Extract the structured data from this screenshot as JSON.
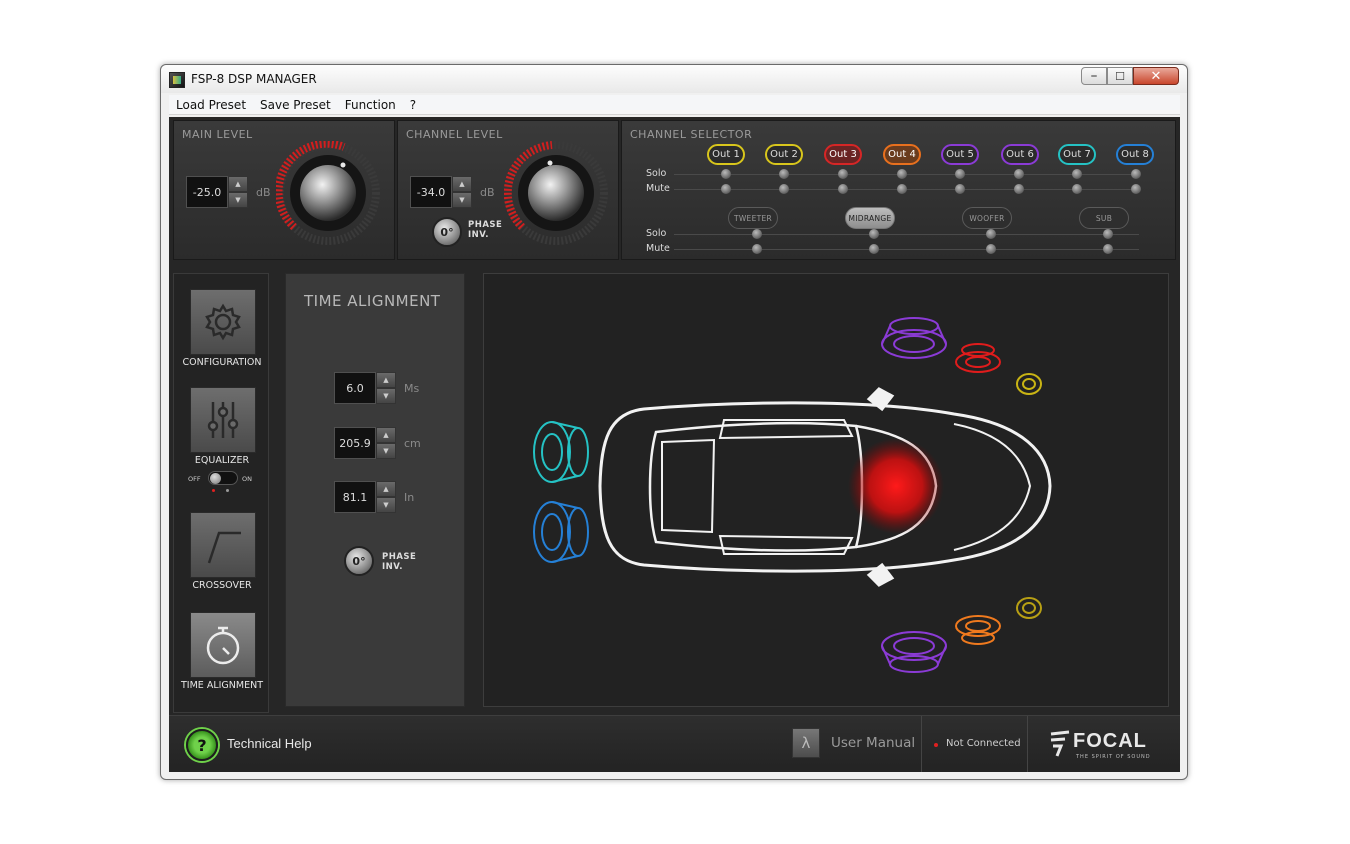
{
  "window": {
    "title": "FSP-8 DSP MANAGER"
  },
  "menu": [
    "Load Preset",
    "Save Preset",
    "Function",
    "?"
  ],
  "main_level": {
    "label": "MAIN LEVEL",
    "value": "-25.0",
    "unit": "dB"
  },
  "channel_level": {
    "label": "CHANNEL LEVEL",
    "value": "-34.0",
    "unit": "dB",
    "phase": "0°",
    "phase_label_1": "PHASE",
    "phase_label_2": "INV."
  },
  "channel_selector": {
    "label": "CHANNEL SELECTOR",
    "outputs": [
      {
        "label": "Out 1",
        "color": "#d8c61c"
      },
      {
        "label": "Out 2",
        "color": "#d8c61c"
      },
      {
        "label": "Out 3",
        "color": "#d62626"
      },
      {
        "label": "Out 4",
        "color": "#e8701e"
      },
      {
        "label": "Out 5",
        "color": "#8b3bd6"
      },
      {
        "label": "Out 6",
        "color": "#8b3bd6"
      },
      {
        "label": "Out 7",
        "color": "#25c2c4"
      },
      {
        "label": "Out 8",
        "color": "#2580d6"
      }
    ],
    "solo_label": "Solo",
    "mute_label": "Mute",
    "groups": [
      "TWEETER",
      "MIDRANGE",
      "WOOFER",
      "SUB"
    ],
    "active_group": "MIDRANGE"
  },
  "nav": {
    "configuration": "CONFIGURATION",
    "equalizer": "EQUALIZER",
    "toggle_off": "OFF",
    "toggle_on": "ON",
    "crossover": "CROSSOVER",
    "time_alignment": "TIME ALIGNMENT"
  },
  "time_alignment": {
    "title": "TIME ALIGNMENT",
    "ms_value": "6.0",
    "ms_unit": "Ms",
    "cm_value": "205.9",
    "cm_unit": "cm",
    "in_value": "81.1",
    "in_unit": "In",
    "phase": "0°",
    "phase_label_1": "PHASE",
    "phase_label_2": "INV."
  },
  "footer": {
    "help": "Technical Help",
    "manual": "User Manual",
    "status": "Not Connected",
    "brand": "FOCAL",
    "tagline": "THE SPIRIT OF SOUND"
  },
  "icons": {
    "config": "gear-icon",
    "eq": "sliders-icon",
    "xover": "crossover-curve-icon",
    "ta": "stopwatch-icon"
  }
}
